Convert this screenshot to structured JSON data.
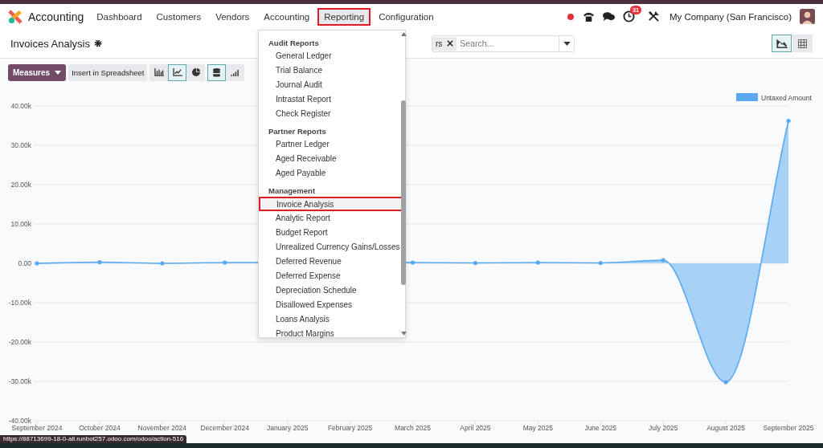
{
  "app": {
    "name": "Accounting"
  },
  "nav": [
    {
      "label": "Dashboard",
      "selected": false,
      "highlighted": false
    },
    {
      "label": "Customers",
      "selected": false,
      "highlighted": false
    },
    {
      "label": "Vendors",
      "selected": false,
      "highlighted": false
    },
    {
      "label": "Accounting",
      "selected": false,
      "highlighted": false
    },
    {
      "label": "Reporting",
      "selected": true,
      "highlighted": true
    },
    {
      "label": "Configuration",
      "selected": false,
      "highlighted": false
    }
  ],
  "systray": {
    "recording": true,
    "activity_badge": "31",
    "company": "My Company (San Francisco)"
  },
  "control_panel": {
    "title": "Invoices Analysis",
    "facet": "rs",
    "search": {
      "placeholder": "Search..."
    }
  },
  "views": [
    {
      "kind": "graph",
      "selected": true
    },
    {
      "kind": "pivot",
      "selected": false
    }
  ],
  "toolbar": {
    "measures": "Measures",
    "spreadsheet": "Insert in Spreadsheet",
    "chart_types": [
      {
        "kind": "bar",
        "selected": false
      },
      {
        "kind": "line",
        "selected": true
      },
      {
        "kind": "pie",
        "selected": false
      }
    ],
    "options": [
      {
        "kind": "stacked",
        "selected": true
      },
      {
        "kind": "cumulative",
        "selected": false
      }
    ]
  },
  "chart_data": {
    "type": "area",
    "categories": [
      "September 2024",
      "October 2024",
      "November 2024",
      "December 2024",
      "January 2025",
      "February 2025",
      "March 2025",
      "April 2025",
      "May 2025",
      "June 2025",
      "July 2025",
      "August 2025",
      "September 2025"
    ],
    "series": [
      {
        "name": "Untaxed Amount",
        "color": "#5aa9ef",
        "values": [
          0,
          300,
          0,
          200,
          null,
          null,
          200,
          100,
          200,
          100,
          800,
          -30200,
          36200
        ]
      }
    ],
    "ylim": [
      -40000,
      40000
    ],
    "grid": true,
    "yticks": [
      {
        "value": 40000,
        "label": "40.00k"
      },
      {
        "value": 30000,
        "label": "30.00k"
      },
      {
        "value": 20000,
        "label": "20.00k"
      },
      {
        "value": 10000,
        "label": "10.00k"
      },
      {
        "value": 0,
        "label": "0.00"
      },
      {
        "value": -10000,
        "label": "-10.00k"
      },
      {
        "value": -20000,
        "label": "-20.00k"
      },
      {
        "value": -30000,
        "label": "-30.00k"
      },
      {
        "value": -40000,
        "label": "-40.00k"
      }
    ]
  },
  "reporting_menu": {
    "sections": [
      {
        "title": "Audit Reports",
        "items": [
          {
            "label": "General Ledger",
            "highlighted": false
          },
          {
            "label": "Trial Balance",
            "highlighted": false
          },
          {
            "label": "Journal Audit",
            "highlighted": false
          },
          {
            "label": "Intrastat Report",
            "highlighted": false
          },
          {
            "label": "Check Register",
            "highlighted": false
          }
        ]
      },
      {
        "title": "Partner Reports",
        "items": [
          {
            "label": "Partner Ledger",
            "highlighted": false
          },
          {
            "label": "Aged Receivable",
            "highlighted": false
          },
          {
            "label": "Aged Payable",
            "highlighted": false
          }
        ]
      },
      {
        "title": "Management",
        "items": [
          {
            "label": "Invoice Analysis",
            "highlighted": true
          },
          {
            "label": "Analytic Report",
            "highlighted": false
          },
          {
            "label": "Budget Report",
            "highlighted": false
          },
          {
            "label": "Unrealized Currency Gains/Losses",
            "highlighted": false
          },
          {
            "label": "Deferred Revenue",
            "highlighted": false
          },
          {
            "label": "Deferred Expense",
            "highlighted": false
          },
          {
            "label": "Depreciation Schedule",
            "highlighted": false
          },
          {
            "label": "Disallowed Expenses",
            "highlighted": false
          },
          {
            "label": "Loans Analysis",
            "highlighted": false
          },
          {
            "label": "Product Margins",
            "highlighted": false
          }
        ]
      }
    ]
  },
  "status_url": "https://88713699-18-0-all.runbot257.odoo.com/odoo/action-516"
}
